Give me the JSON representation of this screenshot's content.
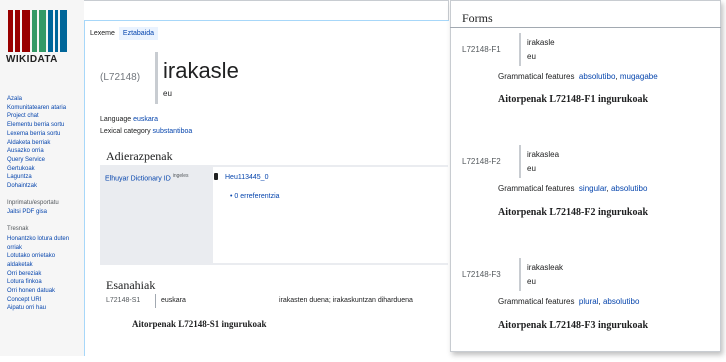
{
  "logo": {
    "text": "WIKIDATA"
  },
  "sidebar": {
    "nav": [
      "Azala",
      "Komunitatearen ataria",
      "Project chat",
      "Elementu berria sortu",
      "Lexema berria sortu",
      "Aldaketa berriak",
      "Ausazko orria",
      "Query Service",
      "Gertukoak",
      "Laguntza",
      "Dohaintzak"
    ],
    "print_heading": "Inprimatu/esportatu",
    "print_items": [
      "Jaitsi PDF gisa"
    ],
    "tools_heading": "Tresnak",
    "tools_items": [
      "Honantzko lotura duten orriak",
      "Lotutako orrietako aldaketak",
      "Orri bereziak",
      "Lotura finkoa",
      "Orri honen datuak",
      "Concept URI",
      "Aipatu orri hau"
    ]
  },
  "tabs": {
    "lexeme": "Lexeme",
    "discussion": "Eztabaida"
  },
  "lexeme": {
    "id": "(L72148)",
    "lemma": "irakasle",
    "lemma_lang": "eu",
    "language_label": "Language",
    "language_value": "euskara",
    "category_label": "Lexical category",
    "category_value": "substantiboa"
  },
  "senses": {
    "title": "Adierazpenak",
    "property": "Elhuyar Dictionary ID",
    "property_lang": "ingeles",
    "value": "Heu113445_0",
    "references": "• 0 erreferentzia"
  },
  "senses_list": {
    "title": "Esanahiak",
    "sense_id": "L72148-S1",
    "sense_lang": "euskara",
    "gloss": "irakasten duena; irakaskuntzan diharduena",
    "statements": "Aitorpenak L72148-S1 ingurukoak"
  },
  "forms": {
    "title": "Forms",
    "label": "Grammatical features",
    "items": [
      {
        "id": "L72148-F1",
        "rep": "irakasle",
        "lang": "eu",
        "f1": "absolutibo",
        "sep": ", ",
        "f2": "mugagabe",
        "statements": "Aitorpenak L72148-F1 ingurukoak"
      },
      {
        "id": "L72148-F2",
        "rep": "irakaslea",
        "lang": "eu",
        "f1": "singular",
        "sep": ", ",
        "f2": "absolutibo",
        "statements": "Aitorpenak L72148-F2 ingurukoak"
      },
      {
        "id": "L72148-F3",
        "rep": "irakasleak",
        "lang": "eu",
        "f1": "plural",
        "sep": ", ",
        "f2": "absolutibo",
        "statements": "Aitorpenak L72148-F3 ingurukoak"
      }
    ]
  },
  "colors": {
    "link": "#0645ad",
    "logo_red": "#990000",
    "logo_green": "#339966",
    "logo_blue": "#006699"
  }
}
